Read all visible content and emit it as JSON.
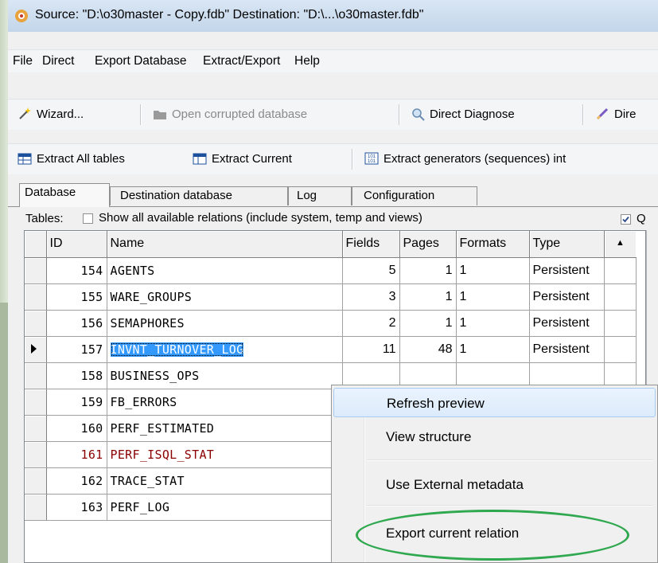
{
  "title": "Source: \"D:\\o30master - Copy.fdb\" Destination: \"D:\\...\\o30master.fdb\"",
  "menu": [
    "File",
    "Direct",
    "Export Database",
    "Extract/Export",
    "Help"
  ],
  "toolbar1": {
    "wizard": "Wizard...",
    "open_corrupted": "Open corrupted database",
    "direct_diagnose": "Direct Diagnose",
    "truncated": "Dire"
  },
  "toolbar2": {
    "extract_all": "Extract All tables",
    "extract_current": "Extract Current",
    "extract_generators": "Extract generators (sequences) int"
  },
  "tabs": [
    "Database",
    "Destination database",
    "Log",
    "Configuration"
  ],
  "tables_label": "Tables:",
  "show_all_label": "Show all available relations (include system, temp and views)",
  "right_check_label": "Q",
  "grid": {
    "headers": [
      "ID",
      "Name",
      "Fields",
      "Pages",
      "Formats",
      "Type"
    ],
    "rows": [
      {
        "id": "154",
        "name": "AGENTS",
        "fields": "5",
        "pages": "1",
        "formats": "1",
        "type": "Persistent"
      },
      {
        "id": "155",
        "name": "WARE_GROUPS",
        "fields": "3",
        "pages": "1",
        "formats": "1",
        "type": "Persistent"
      },
      {
        "id": "156",
        "name": "SEMAPHORES",
        "fields": "2",
        "pages": "1",
        "formats": "1",
        "type": "Persistent"
      },
      {
        "id": "157",
        "name": "INVNT_TURNOVER_LOG",
        "fields": "11",
        "pages": "48",
        "formats": "1",
        "type": "Persistent"
      },
      {
        "id": "158",
        "name": "BUSINESS_OPS",
        "fields": "",
        "pages": "",
        "formats": "",
        "type": ""
      },
      {
        "id": "159",
        "name": "FB_ERRORS",
        "fields": "",
        "pages": "",
        "formats": "",
        "type": ""
      },
      {
        "id": "160",
        "name": "PERF_ESTIMATED",
        "fields": "",
        "pages": "",
        "formats": "",
        "type": ""
      },
      {
        "id": "161",
        "name": "PERF_ISQL_STAT",
        "fields": "",
        "pages": "",
        "formats": "",
        "type": ""
      },
      {
        "id": "162",
        "name": "TRACE_STAT",
        "fields": "",
        "pages": "",
        "formats": "",
        "type": ""
      },
      {
        "id": "163",
        "name": "PERF_LOG",
        "fields": "",
        "pages": "",
        "formats": "",
        "type": ""
      }
    ]
  },
  "context_menu": [
    "Refresh preview",
    "View structure",
    "Use External metadata",
    "Export current relation"
  ],
  "colors": {
    "selection": "#3399ff",
    "highlight_ellipse": "#2fa84f",
    "red_row": "#8b0000"
  }
}
